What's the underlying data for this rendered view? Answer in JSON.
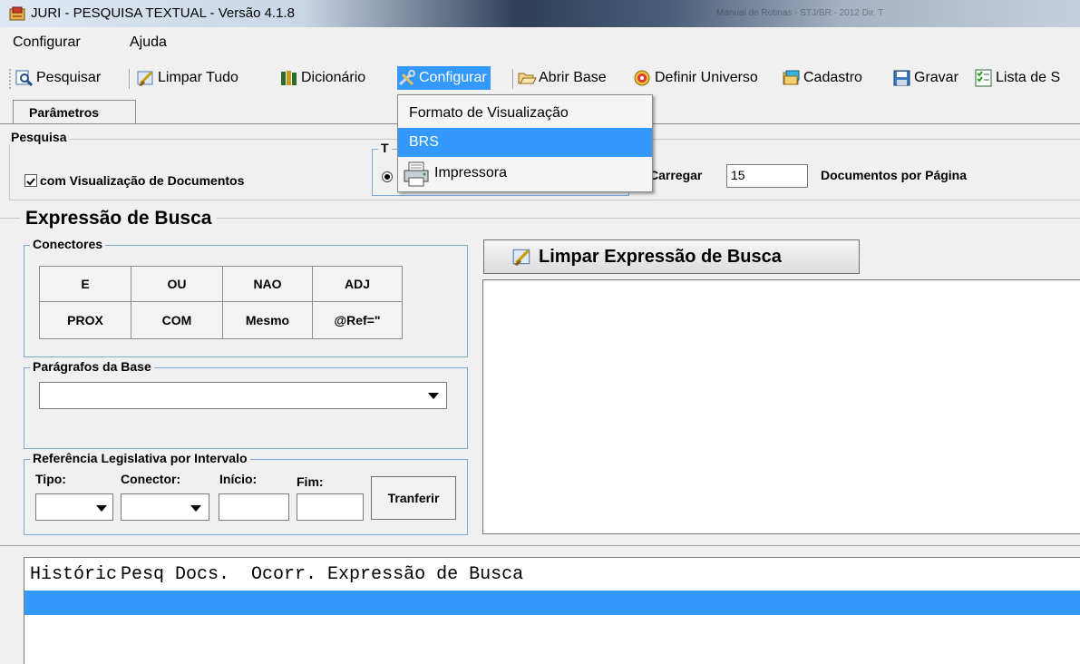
{
  "window": {
    "title": "JURI - PESQUISA TEXTUAL - Versão 4.1.8",
    "blurred_title": "Manual de Rotinas - STJ/BR - 2012 Dir. T"
  },
  "menu": {
    "configurar": "Configurar",
    "ajuda": "Ajuda"
  },
  "toolbar": {
    "pesquisar": "Pesquisar",
    "limpar_tudo": "Limpar Tudo",
    "dicionario": "Dicionário",
    "configurar": "Configurar",
    "abrir_base": "Abrir Base",
    "definir_universo": "Definir Universo",
    "cadastro": "Cadastro",
    "gravar": "Gravar",
    "lista": "Lista de S"
  },
  "dropdown": {
    "items": [
      "Formato de Visualização",
      "BRS",
      "Impressora"
    ],
    "selected": "BRS"
  },
  "tab": {
    "label": "Parâmetros"
  },
  "pesquisa": {
    "legend": "Pesquisa",
    "checkbox_label": "com Visualização de Documentos",
    "checkbox_checked": true,
    "group_t_legend": "T",
    "carregar_label": "Carregar",
    "carregar_value": "15",
    "docs_label": "Documentos por Página"
  },
  "expressao": {
    "title": "Expressão de Busca",
    "clear_button": "Limpar Expressão de Busca"
  },
  "conectores": {
    "legend": "Conectores",
    "row1": [
      "E",
      "OU",
      "NAO",
      "ADJ"
    ],
    "row2": [
      "PROX",
      "COM",
      "Mesmo",
      "@Ref=\""
    ]
  },
  "paragrafos": {
    "legend": "Parágrafos da Base"
  },
  "referencia": {
    "legend": "Referência Legislativa por Intervalo",
    "tipo": "Tipo:",
    "conector": "Conector:",
    "inicio": "Início:",
    "fim": "Fim:",
    "transfer": "Tranferir"
  },
  "historico": {
    "header": "Históric Pesq Docs.  Ocorr. Expressão de Busca"
  }
}
